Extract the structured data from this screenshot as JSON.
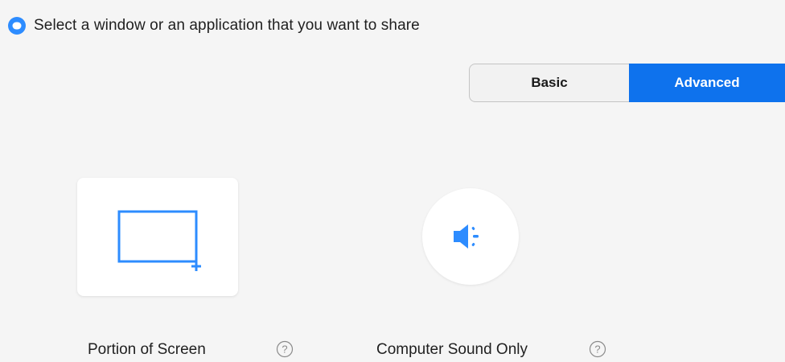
{
  "header": {
    "icon": "zoom-share-icon",
    "text": "Select a window or an application that you want to share"
  },
  "mode_toggle": {
    "options": [
      "Basic",
      "Advanced"
    ],
    "selected": "Advanced"
  },
  "options": [
    {
      "label": "Portion of Screen",
      "icon": "screen-portion-icon",
      "help_icon": "help-icon",
      "help_text": "?"
    },
    {
      "label": "Computer Sound Only",
      "icon": "speaker-icon",
      "help_icon": "help-icon",
      "help_text": "?"
    }
  ],
  "colors": {
    "accent": "#0e72ed",
    "icon_blue": "#2d8cff",
    "background": "#f5f5f5",
    "help_gray": "#8a8a8a"
  }
}
